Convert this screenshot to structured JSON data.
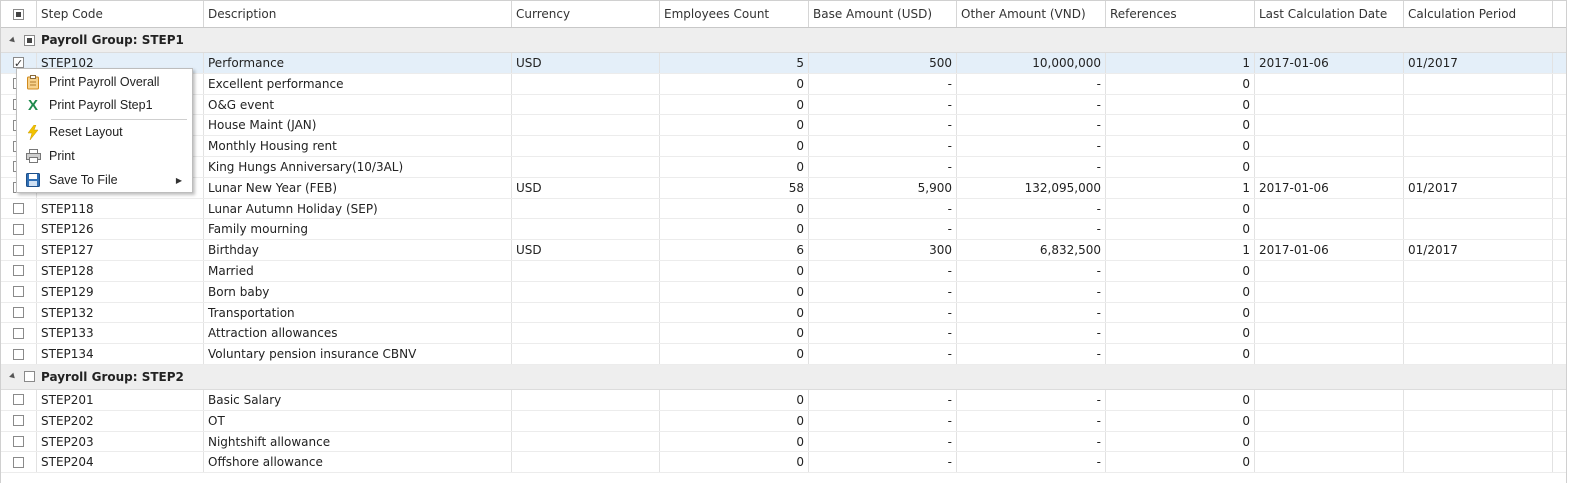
{
  "columns": [
    "Step Code",
    "Description",
    "Currency",
    "Employees Count",
    "Base Amount (USD)",
    "Other Amount (VND)",
    "References",
    "Last Calculation Date",
    "Calculation Period"
  ],
  "groups": [
    {
      "label": "Payroll Group: STEP1",
      "rows": [
        {
          "code": "STEP102",
          "desc": "Performance",
          "currency": "USD",
          "emp": "5",
          "base": "500",
          "other": "10,000,000",
          "ref": "1",
          "date": "2017-01-06",
          "period": "01/2017"
        },
        {
          "code": "",
          "desc": "Excellent performance",
          "currency": "",
          "emp": "0",
          "base": "-",
          "other": "-",
          "ref": "0",
          "date": "",
          "period": ""
        },
        {
          "code": "",
          "desc": "O&G event",
          "currency": "",
          "emp": "0",
          "base": "-",
          "other": "-",
          "ref": "0",
          "date": "",
          "period": ""
        },
        {
          "code": "",
          "desc": "House Maint (JAN)",
          "currency": "",
          "emp": "0",
          "base": "-",
          "other": "-",
          "ref": "0",
          "date": "",
          "period": ""
        },
        {
          "code": "",
          "desc": "Monthly Housing rent",
          "currency": "",
          "emp": "0",
          "base": "-",
          "other": "-",
          "ref": "0",
          "date": "",
          "period": ""
        },
        {
          "code": "",
          "desc": "King Hungs Anniversary(10/3AL)",
          "currency": "",
          "emp": "0",
          "base": "-",
          "other": "-",
          "ref": "0",
          "date": "",
          "period": ""
        },
        {
          "code": "",
          "desc": "Lunar New Year (FEB)",
          "currency": "USD",
          "emp": "58",
          "base": "5,900",
          "other": "132,095,000",
          "ref": "1",
          "date": "2017-01-06",
          "period": "01/2017"
        },
        {
          "code": "STEP118",
          "desc": "Lunar Autumn Holiday (SEP)",
          "currency": "",
          "emp": "0",
          "base": "-",
          "other": "-",
          "ref": "0",
          "date": "",
          "period": ""
        },
        {
          "code": "STEP126",
          "desc": "Family mourning",
          "currency": "",
          "emp": "0",
          "base": "-",
          "other": "-",
          "ref": "0",
          "date": "",
          "period": ""
        },
        {
          "code": "STEP127",
          "desc": "Birthday",
          "currency": "USD",
          "emp": "6",
          "base": "300",
          "other": "6,832,500",
          "ref": "1",
          "date": "2017-01-06",
          "period": "01/2017"
        },
        {
          "code": "STEP128",
          "desc": "Married",
          "currency": "",
          "emp": "0",
          "base": "-",
          "other": "-",
          "ref": "0",
          "date": "",
          "period": ""
        },
        {
          "code": "STEP129",
          "desc": "Born baby",
          "currency": "",
          "emp": "0",
          "base": "-",
          "other": "-",
          "ref": "0",
          "date": "",
          "period": ""
        },
        {
          "code": "STEP132",
          "desc": "Transportation",
          "currency": "",
          "emp": "0",
          "base": "-",
          "other": "-",
          "ref": "0",
          "date": "",
          "period": ""
        },
        {
          "code": "STEP133",
          "desc": "Attraction allowances",
          "currency": "",
          "emp": "0",
          "base": "-",
          "other": "-",
          "ref": "0",
          "date": "",
          "period": ""
        },
        {
          "code": "STEP134",
          "desc": "Voluntary pension insurance CBNV",
          "currency": "",
          "emp": "0",
          "base": "-",
          "other": "-",
          "ref": "0",
          "date": "",
          "period": ""
        }
      ]
    },
    {
      "label": "Payroll Group: STEP2",
      "rows": [
        {
          "code": "STEP201",
          "desc": "Basic Salary",
          "currency": "",
          "emp": "0",
          "base": "-",
          "other": "-",
          "ref": "0",
          "date": "",
          "period": ""
        },
        {
          "code": "STEP202",
          "desc": "OT",
          "currency": "",
          "emp": "0",
          "base": "-",
          "other": "-",
          "ref": "0",
          "date": "",
          "period": ""
        },
        {
          "code": "STEP203",
          "desc": "Nightshift allowance",
          "currency": "",
          "emp": "0",
          "base": "-",
          "other": "-",
          "ref": "0",
          "date": "",
          "period": ""
        },
        {
          "code": "STEP204",
          "desc": "Offshore allowance",
          "currency": "",
          "emp": "0",
          "base": "-",
          "other": "-",
          "ref": "0",
          "date": "",
          "period": ""
        }
      ]
    }
  ],
  "context_menu": {
    "items": [
      {
        "label": "Print Payroll Overall",
        "icon": "clipboard-icon"
      },
      {
        "label": "Print Payroll Step1",
        "icon": "excel-icon"
      },
      {
        "label": "Reset Layout",
        "icon": "lightning-icon"
      },
      {
        "label": "Print",
        "icon": "printer-icon"
      },
      {
        "label": "Save To File",
        "icon": "floppy-disk-icon"
      }
    ]
  },
  "colors": {
    "selected_row": "#e4eff9",
    "group_band": "#eeeeee",
    "excel_green": "#1e8a4c",
    "lightning_yellow": "#f2c200",
    "clipboard_orange": "#e8a33c",
    "floppy_blue": "#2f6fb5"
  }
}
